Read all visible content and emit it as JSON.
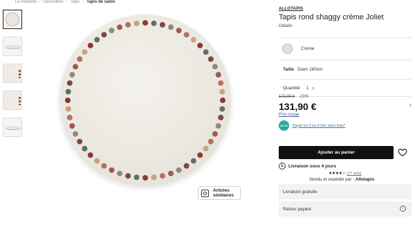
{
  "breadcrumb": [
    {
      "label": "La Redoute"
    },
    {
      "label": "Décoration"
    },
    {
      "label": "Tapis"
    },
    {
      "label": "Tapis de salon"
    }
  ],
  "breadcrumb_separator": "/",
  "gallery": {
    "thumbnails": [
      "rug-top-view",
      "rug-side-view",
      "rug-edge-detail",
      "rug-pompom-detail",
      "rug-fringe-detail"
    ],
    "similar_label_line1": "Articles",
    "similar_label_line2": "similaires"
  },
  "rug": {
    "dot_colors": [
      "#8a3b34",
      "#b96f63",
      "#8c8c7e",
      "#5f6f6a",
      "#c9a27c",
      "#a05a4c",
      "#7a4a3e"
    ]
  },
  "product": {
    "brand": "ALLOTAPIS",
    "title": "Tapis rond shaggy crème Joliet",
    "details_label": "Détails",
    "color_value": "Crème",
    "color_hex": "#e4e1da",
    "size_label": "Taille",
    "size_value": "Diam 160cm",
    "qty_label": "Quantité",
    "qty_value": "1",
    "old_price": "172,00 €",
    "discount": "-23%",
    "price": "131,90 €",
    "price_tag": "Prix rouge",
    "pay_logo": "4X 3X",
    "pay_text": "Payer en 3 ou 4 fois sans frais*",
    "add_to_cart": "Ajouter au panier",
    "delivery": "Livraison sous 4 jours",
    "stars": "★★★★☆",
    "review_count": "(77 avis)",
    "seller_prefix": "Vendu et expédié par :",
    "seller_name": "Allotapis",
    "free_delivery": "Livraison gratuite",
    "paid_return": "Retour payant",
    "info_glyph": "i"
  }
}
